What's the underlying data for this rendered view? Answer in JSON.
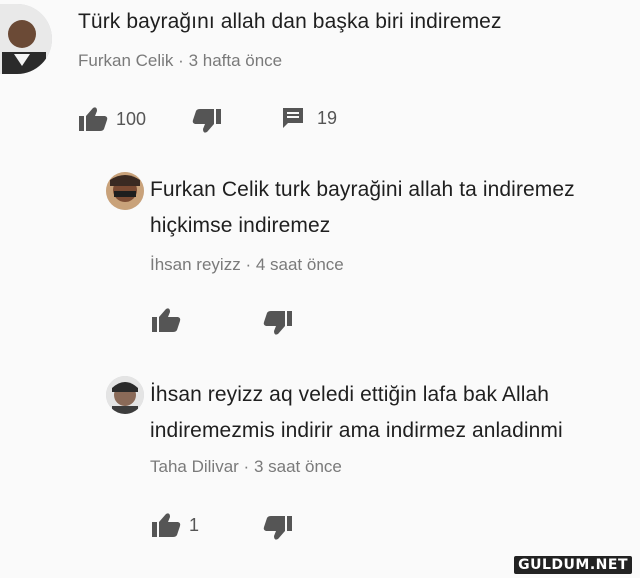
{
  "comments": [
    {
      "lines": [
        "Türk bayrağını allah dan başka biri indiremez"
      ],
      "author": "Furkan Celik",
      "time": "3 hafta önce",
      "likes": "100",
      "replies": "19"
    },
    {
      "lines": [
        "Furkan Celik turk bayrağini allah ta indiremez",
        "hiçkimse indiremez"
      ],
      "author": "İhsan reyizz",
      "time": "4 saat önce"
    },
    {
      "lines": [
        "İhsan reyizz aq veledi ettiğin lafa bak Allah",
        "indiremezmis indirir ama indirmez anladinmi"
      ],
      "author": "Taha Dilivar",
      "time": "3 saat önce",
      "likes": "1"
    }
  ],
  "separator": "·",
  "watermark": "GULDUM.NET",
  "icons": [
    "thumb-up-icon",
    "thumb-down-icon",
    "reply-icon"
  ],
  "colors": {
    "background": "#fafafa",
    "text": "#1f1f1f",
    "meta": "#7a7a7a",
    "icon": "#555555"
  }
}
